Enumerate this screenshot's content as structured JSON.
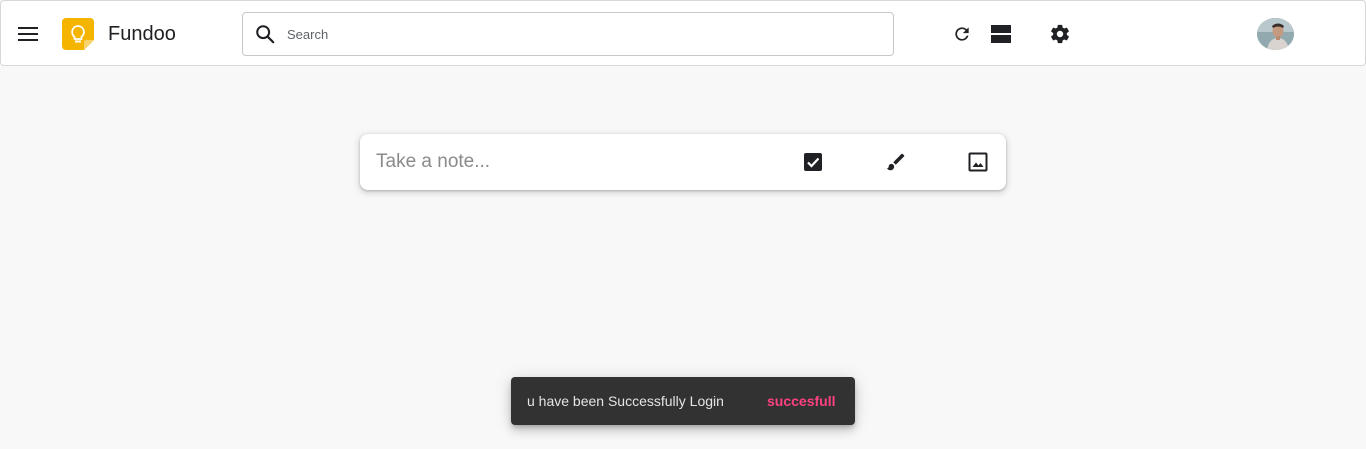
{
  "header": {
    "app_title": "Fundoo",
    "menu_icon": "menu-icon",
    "logo_icon": "lightbulb-keep-logo",
    "logo_color": "#f4b400"
  },
  "search": {
    "placeholder": "Search",
    "value": "",
    "icon": "search-icon"
  },
  "toolbar": {
    "icons": [
      "refresh-icon",
      "view-agenda-icon",
      "settings-icon"
    ]
  },
  "account": {
    "avatar_icon": "avatar"
  },
  "note_input": {
    "placeholder": "Take a note...",
    "icons": [
      "checkbox-icon",
      "brush-icon",
      "image-icon"
    ]
  },
  "snackbar": {
    "message": "u have been Successfully Login",
    "action": "succesfull",
    "action_color": "#ff4081",
    "background": "#323232"
  },
  "colors": {
    "page_background": "#f8f8f8",
    "header_background": "#ffffff"
  }
}
